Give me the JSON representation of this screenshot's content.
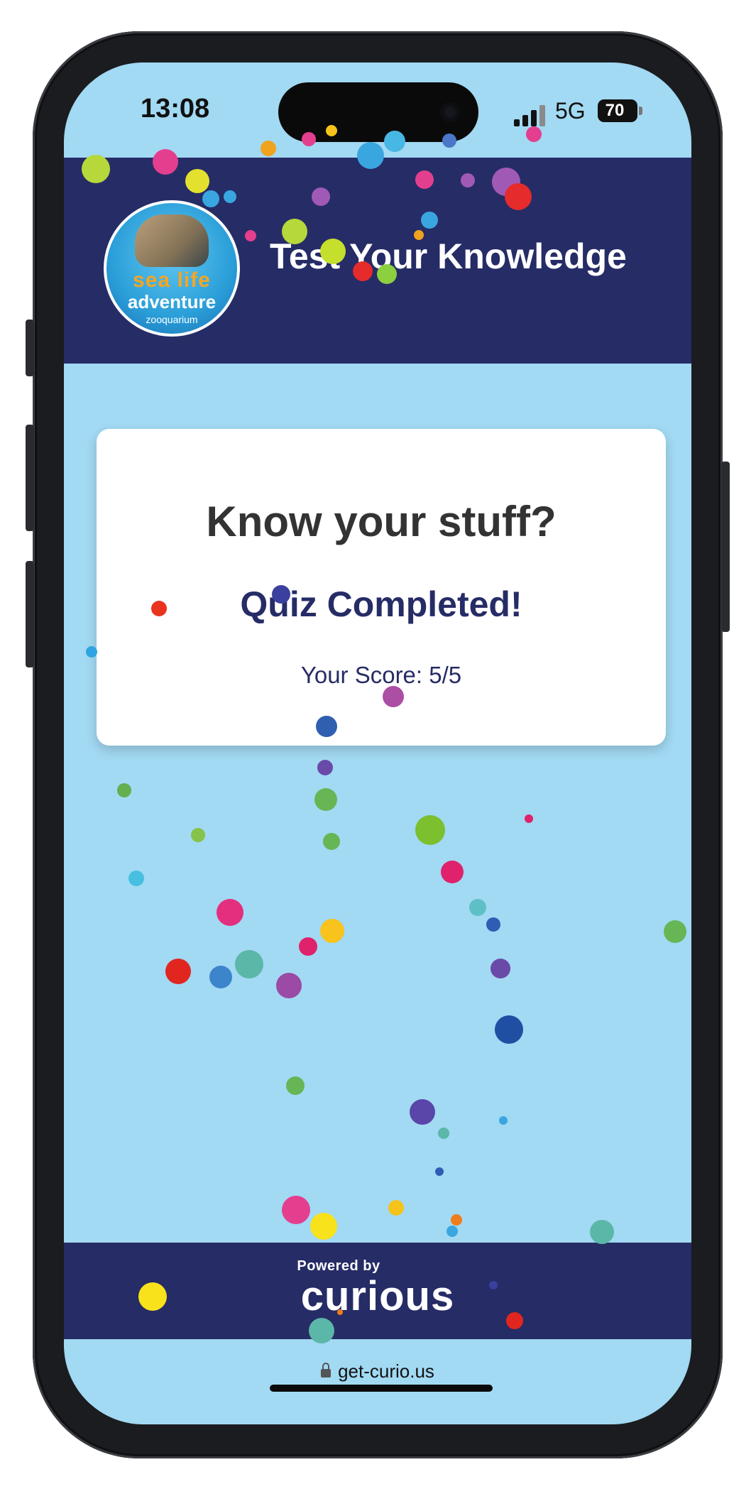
{
  "status_bar": {
    "time": "13:08",
    "network": "5G",
    "battery": "70"
  },
  "header": {
    "logo": {
      "line1": "sea life",
      "line2": "adventure",
      "line3": "zooquarium"
    },
    "title": "Test Your Knowledge"
  },
  "card": {
    "heading": "Know your stuff?",
    "status": "Quiz Completed!",
    "score": "Your Score: 5/5"
  },
  "footer": {
    "powered_by": "Powered by",
    "brand": "curious"
  },
  "browser": {
    "url": "get-curio.us"
  },
  "colors": {
    "background": "#a2d9f3",
    "header_bg": "#262c66",
    "accent_text": "#262c66",
    "heading_text": "#333333"
  }
}
